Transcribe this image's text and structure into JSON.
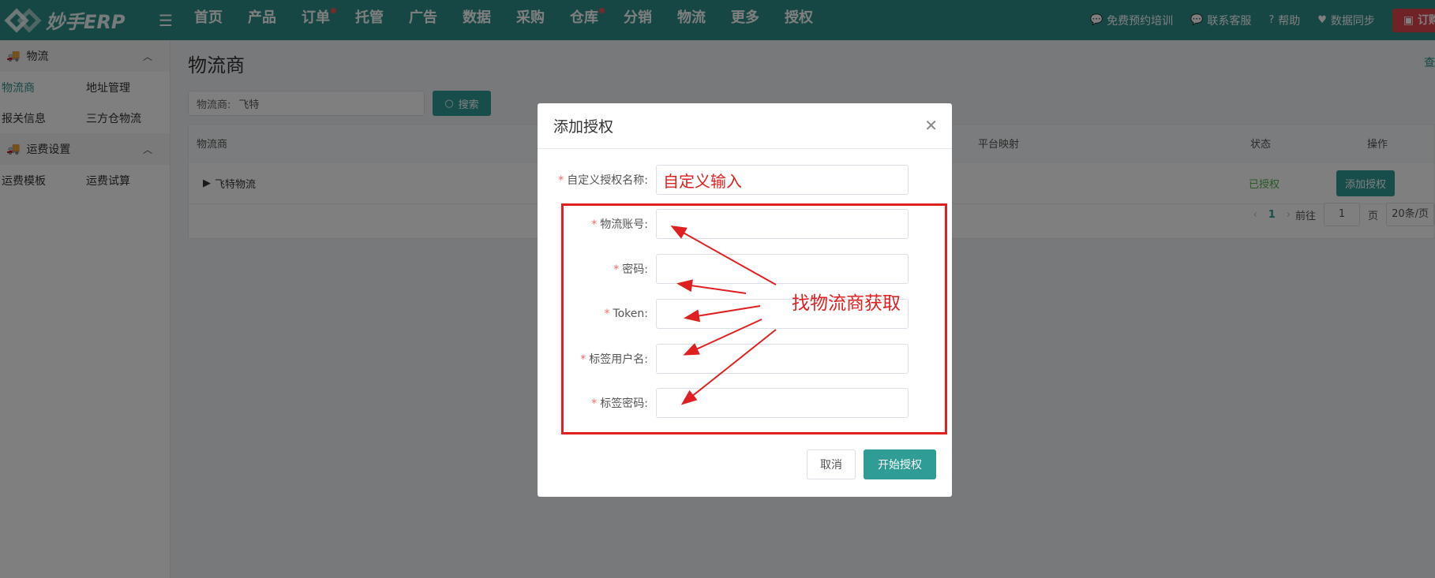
{
  "brand": {
    "name": "妙手ERP"
  },
  "nav": [
    {
      "label": "首页",
      "dot": false
    },
    {
      "label": "产品",
      "dot": false
    },
    {
      "label": "订单",
      "dot": true
    },
    {
      "label": "托管",
      "dot": false
    },
    {
      "label": "广告",
      "dot": false
    },
    {
      "label": "数据",
      "dot": false
    },
    {
      "label": "采购",
      "dot": false
    },
    {
      "label": "仓库",
      "dot": true
    },
    {
      "label": "分销",
      "dot": false
    },
    {
      "label": "物流",
      "dot": false
    },
    {
      "label": "更多",
      "dot": false
    },
    {
      "label": "授权",
      "dot": false
    }
  ],
  "topright": {
    "training": "免费预约培训",
    "support": "联系客服",
    "help": "帮助",
    "sync": "数据同步",
    "order": "订购"
  },
  "sidebar": {
    "group1": "物流",
    "row1": [
      "物流商",
      "地址管理"
    ],
    "row2": [
      "报关信息",
      "三方仓物流"
    ],
    "group2": "运费设置",
    "row3": [
      "运费模板",
      "运费试算"
    ]
  },
  "page": {
    "title": "物流商",
    "right_link": "查"
  },
  "search": {
    "label": "物流商:",
    "value": "飞特",
    "button": "搜索"
  },
  "table": {
    "headers": {
      "provider": "物流商",
      "mapping": "平台映射",
      "status": "状态",
      "action": "操作"
    },
    "rows": [
      {
        "provider": "飞特物流",
        "status": "已授权",
        "action": "添加授权"
      }
    ]
  },
  "pager": {
    "current": "1",
    "goto_label": "前往",
    "goto_value": "1",
    "page_unit": "页",
    "size": "20条/页"
  },
  "modal": {
    "title": "添加授权",
    "fields": [
      {
        "label": "自定义授权名称:",
        "value": "自定义输入"
      },
      {
        "label": "物流账号:",
        "value": ""
      },
      {
        "label": "密码:",
        "value": ""
      },
      {
        "label": "Token:",
        "value": ""
      },
      {
        "label": "标签用户名:",
        "value": ""
      },
      {
        "label": "标签密码:",
        "value": ""
      }
    ],
    "cancel": "取消",
    "submit": "开始授权",
    "annotation": "找物流商获取"
  },
  "colors": {
    "primary": "#2f8f8a",
    "button": "#2f9c96",
    "annotation": "#e02020",
    "authorized": "#52b34b"
  }
}
